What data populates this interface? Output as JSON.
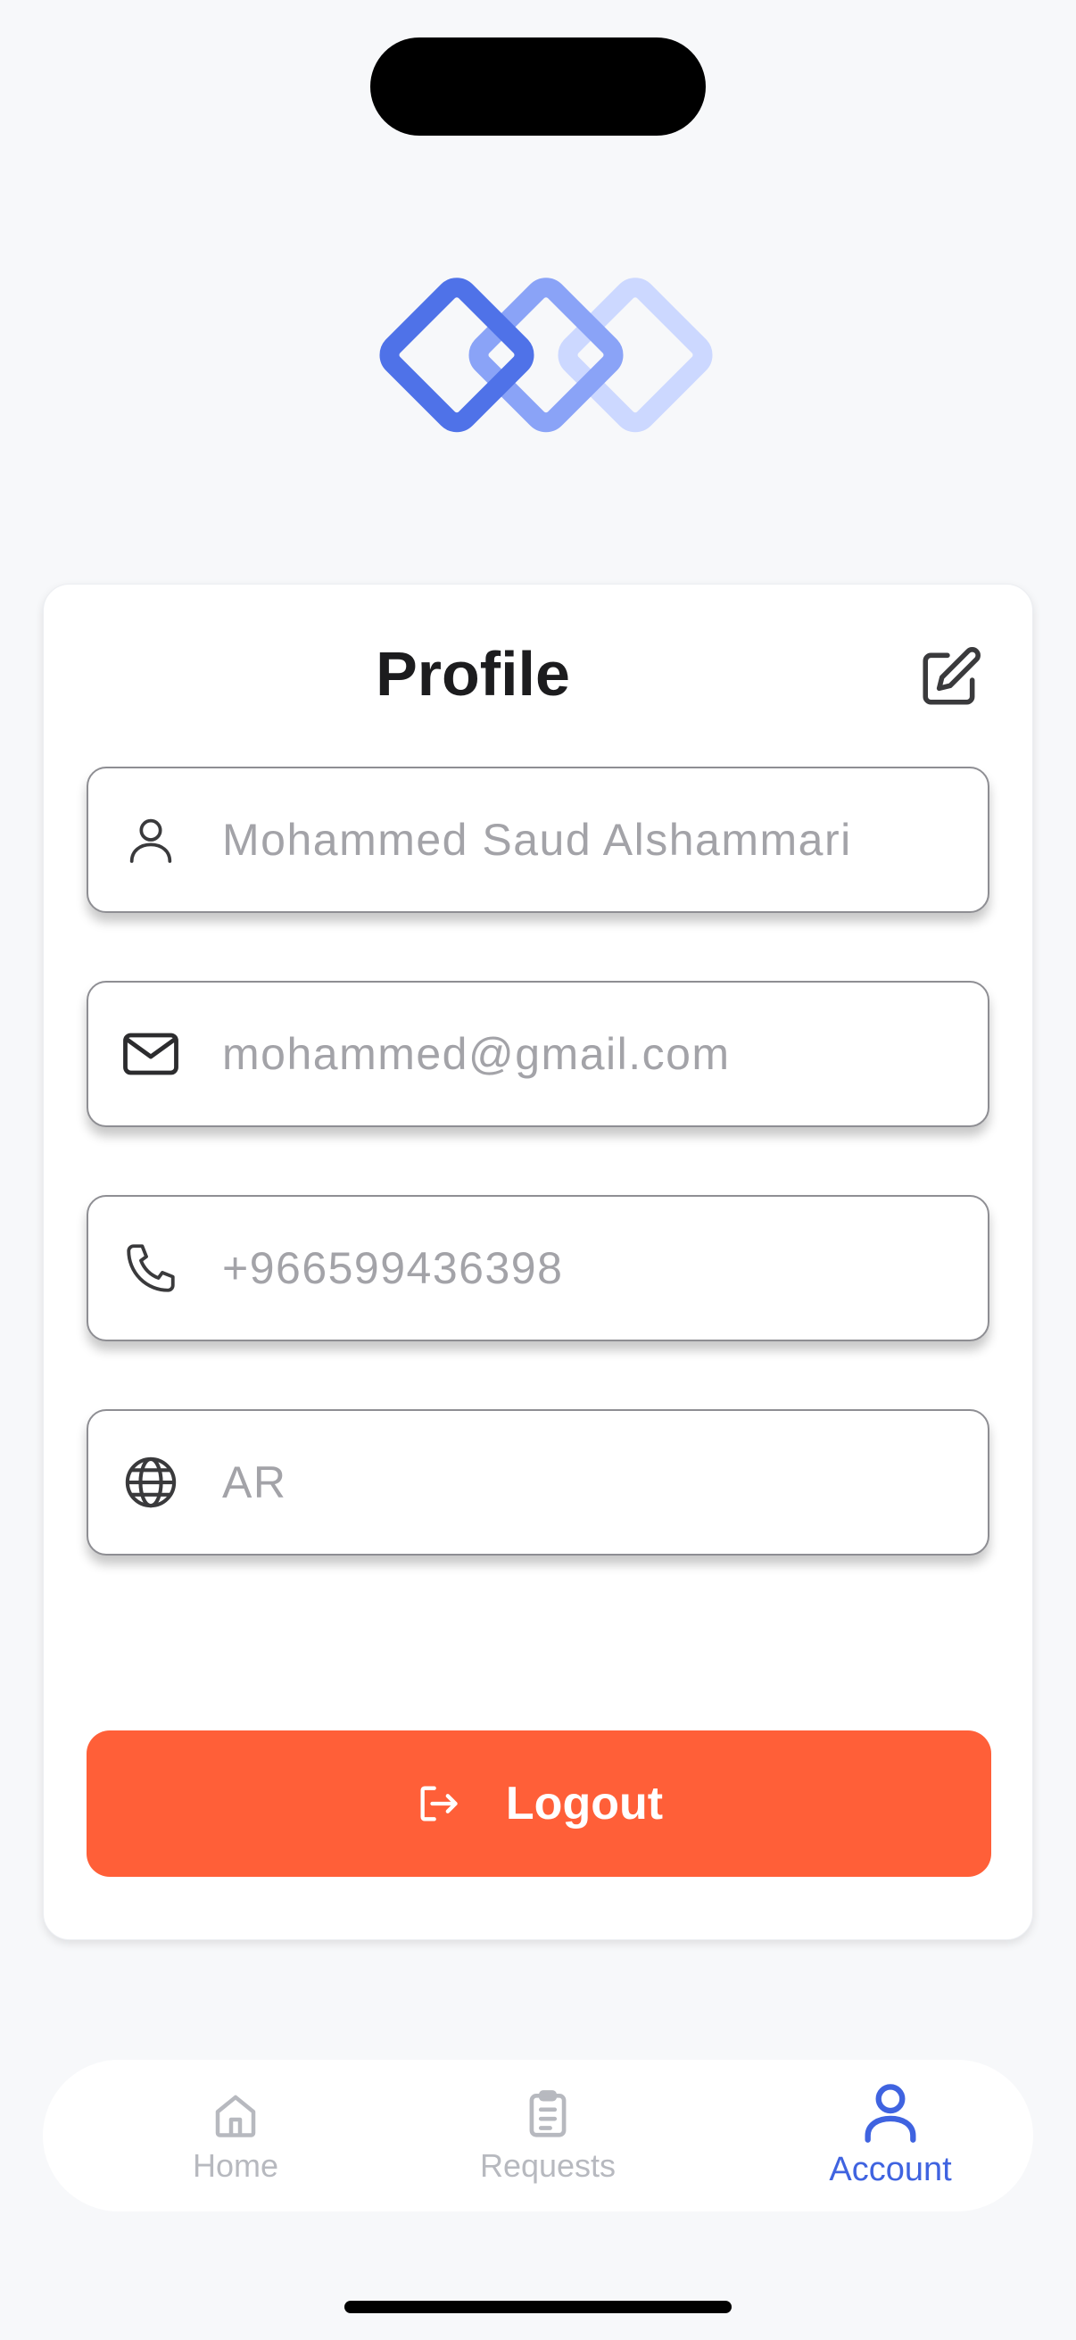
{
  "profile": {
    "title": "Profile",
    "fields": [
      {
        "icon": "user-icon",
        "value": "Mohammed Saud Alshammari"
      },
      {
        "icon": "mail-icon",
        "value": "mohammed@gmail.com"
      },
      {
        "icon": "phone-icon",
        "value": "+966599436398"
      },
      {
        "icon": "globe-icon",
        "value": "AR"
      }
    ],
    "logout_label": "Logout"
  },
  "tabbar": {
    "tabs": [
      {
        "label": "Home",
        "icon": "home-icon",
        "active": false
      },
      {
        "label": "Requests",
        "icon": "clipboard-icon",
        "active": false
      },
      {
        "label": "Account",
        "icon": "user-icon",
        "active": true
      }
    ]
  },
  "colors": {
    "accent": "#3f63e0",
    "logout": "#ff5f38",
    "background": "#f7f8fa"
  }
}
